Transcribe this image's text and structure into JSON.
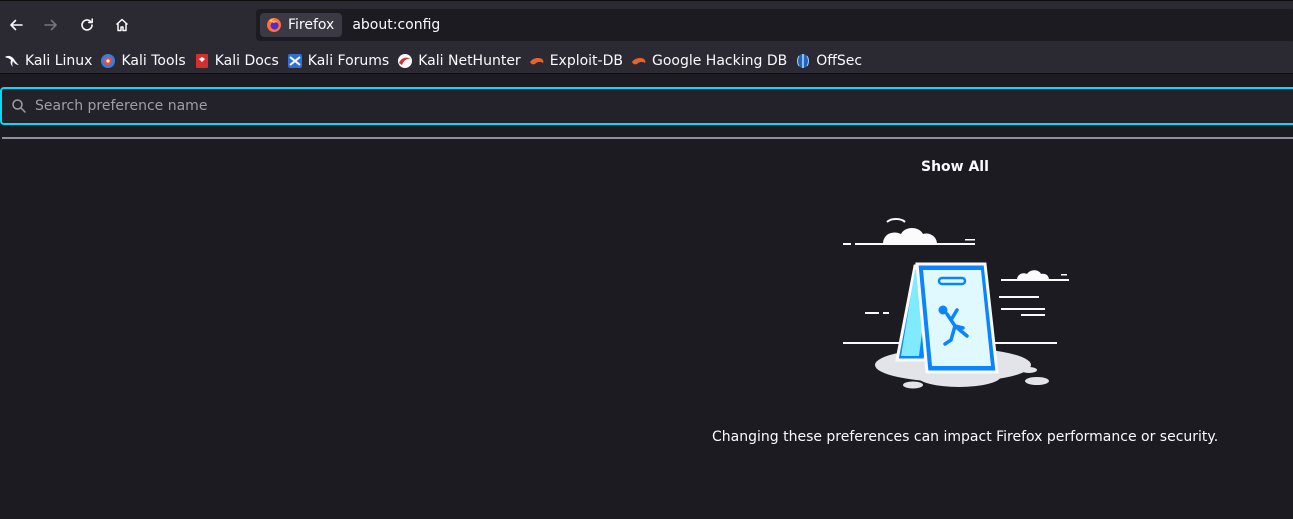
{
  "toolbar": {
    "back_icon": "arrow-left-icon",
    "forward_icon": "arrow-right-icon",
    "reload_icon": "reload-icon",
    "home_icon": "home-icon"
  },
  "urlbar": {
    "identity_label": "Firefox",
    "url": "about:config"
  },
  "bookmarks": [
    {
      "label": "Kali Linux",
      "icon": "kali-dragon-icon"
    },
    {
      "label": "Kali Tools",
      "icon": "kali-tools-icon"
    },
    {
      "label": "Kali Docs",
      "icon": "kali-docs-icon"
    },
    {
      "label": "Kali Forums",
      "icon": "kali-forums-icon"
    },
    {
      "label": "Kali NetHunter",
      "icon": "kali-nethunter-icon"
    },
    {
      "label": "Exploit-DB",
      "icon": "exploit-db-icon"
    },
    {
      "label": "Google Hacking DB",
      "icon": "ghdb-icon"
    },
    {
      "label": "OffSec",
      "icon": "offsec-icon"
    }
  ],
  "search": {
    "placeholder": "Search preference name",
    "value": ""
  },
  "main": {
    "show_all_label": "Show All",
    "warning_text": "Changing these preferences can impact Firefox performance or security."
  },
  "colors": {
    "accent": "#00ddff",
    "background": "#1c1b22",
    "toolbar": "#2b2a33",
    "illustration_blue": "#0a84ff"
  }
}
